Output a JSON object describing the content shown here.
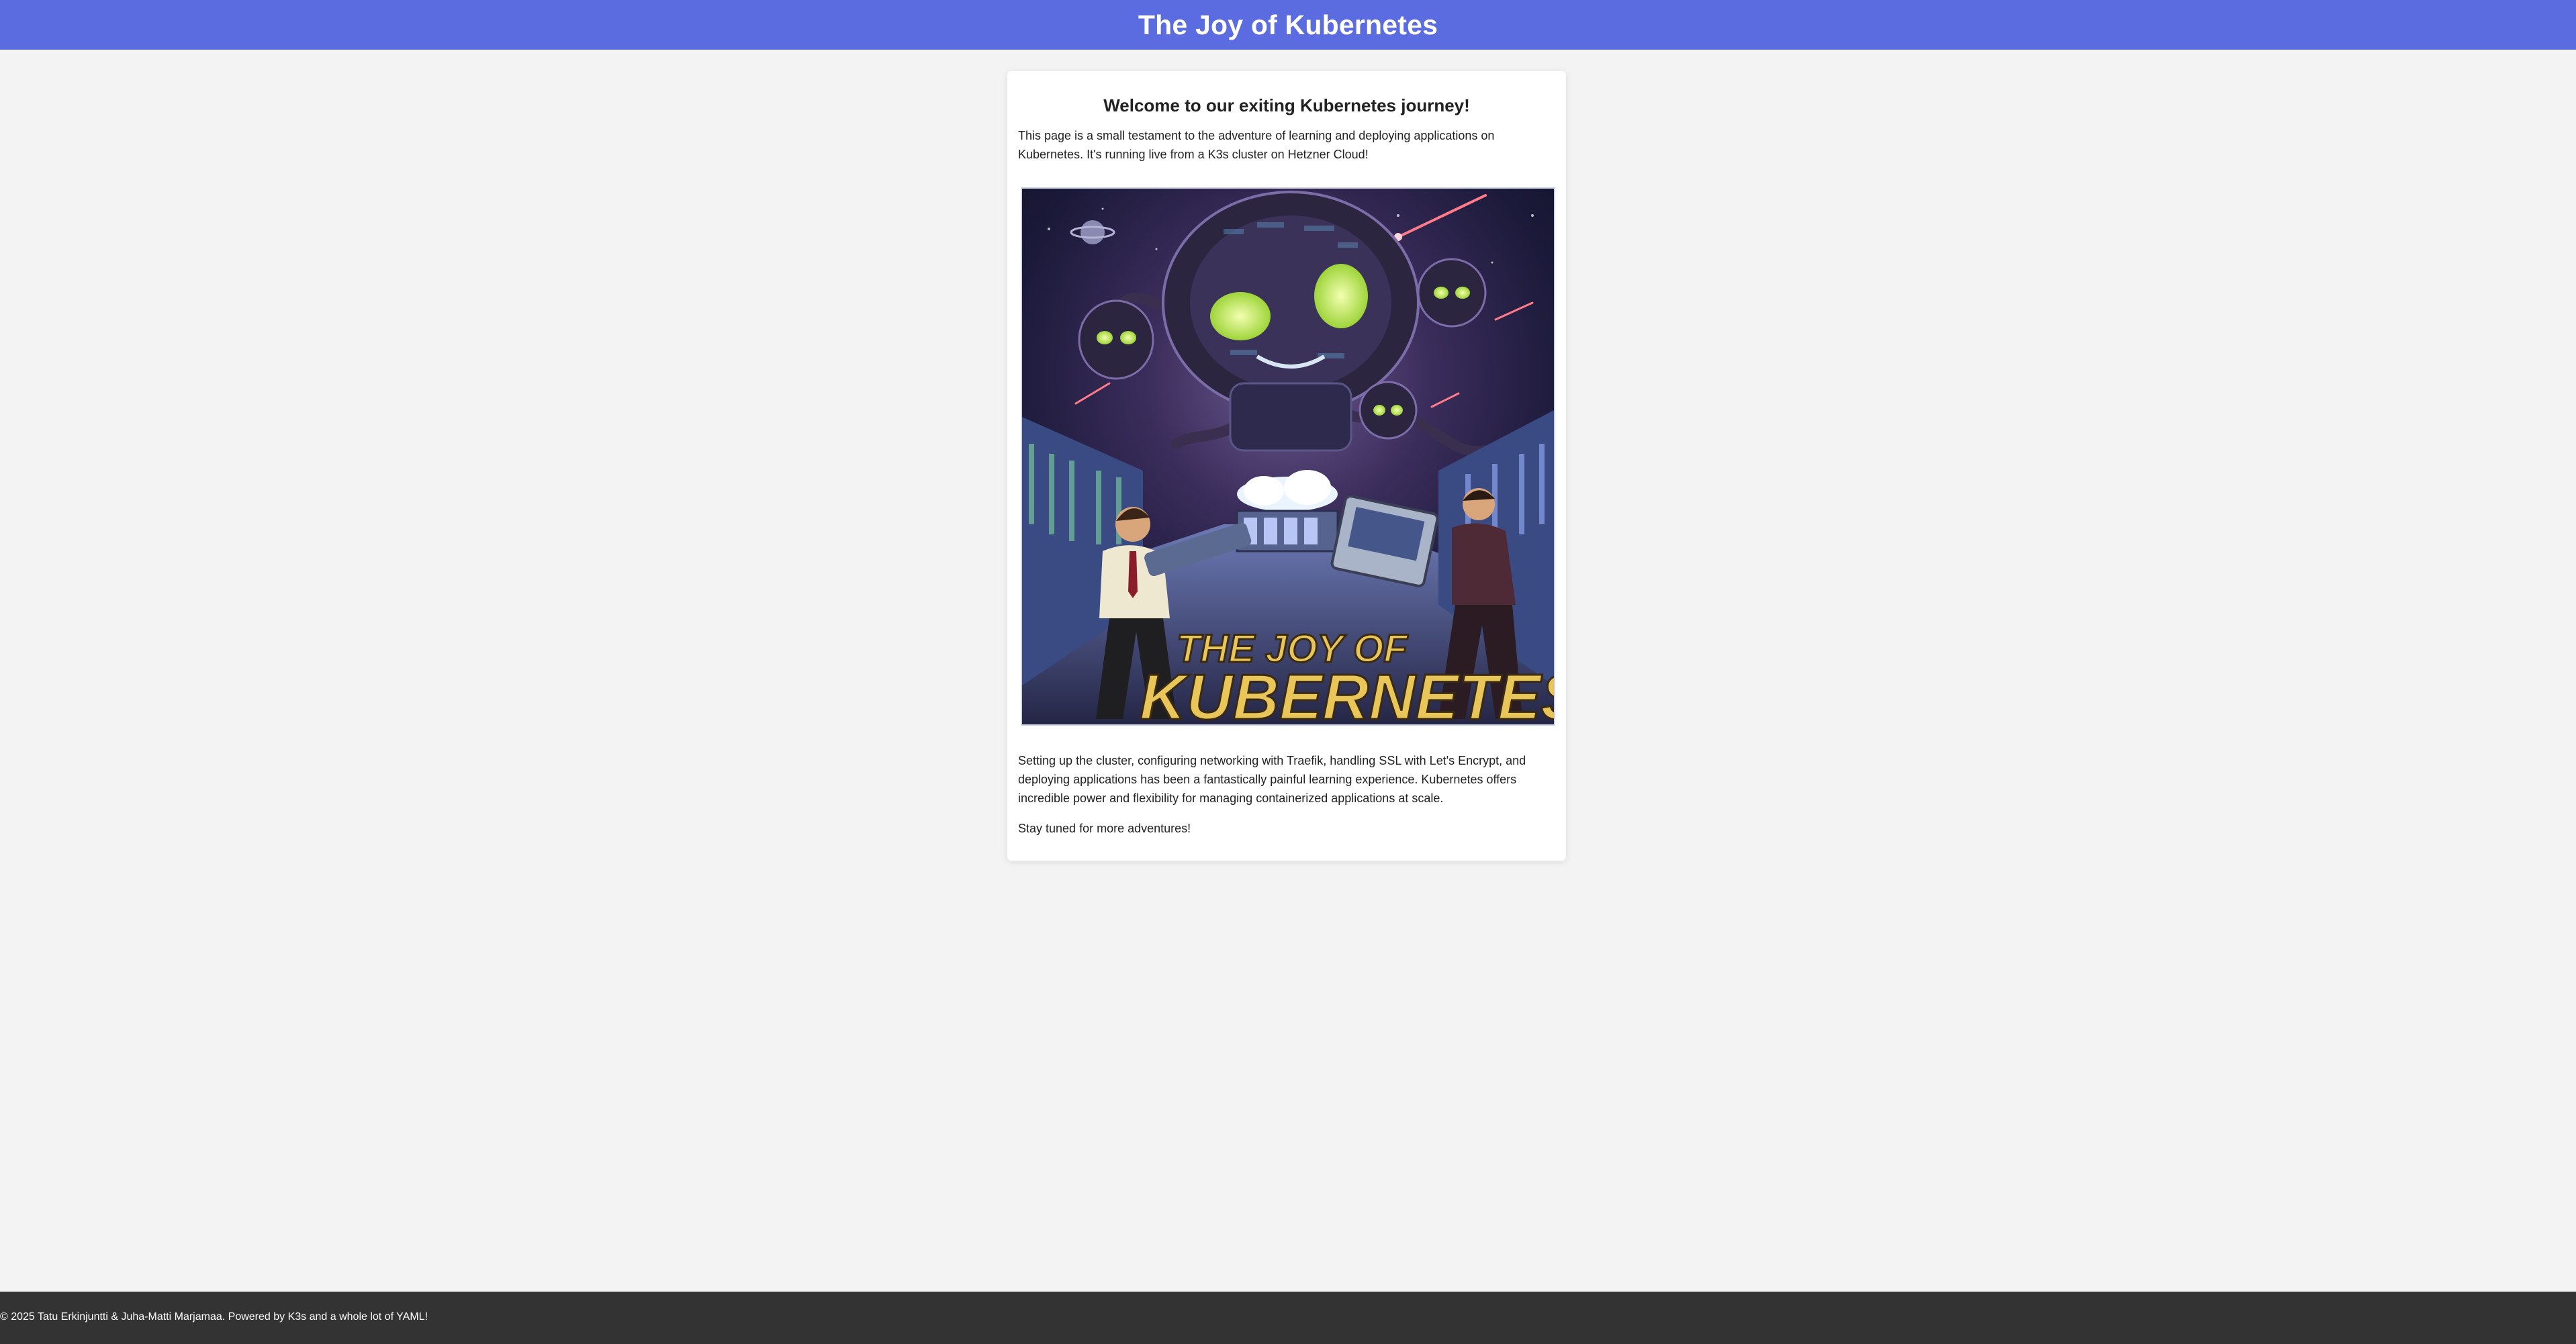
{
  "header": {
    "title": "The Joy of Kubernetes"
  },
  "main": {
    "heading": "Welcome to our exiting Kubernetes journey!",
    "intro": "This page is a small testament to the adventure of learning and deploying applications on Kubernetes. It's running live from a K3s cluster on Hetzner Cloud!",
    "body": "Setting up the cluster, configuring networking with Traefik, handling SSL with Let's Encrypt, and deploying applications has been a fantastically painful learning experience. Kubernetes offers incredible power and flexibility for managing containerized applications at scale.",
    "closing": "Stay tuned for more adventures!",
    "poster": {
      "line1": "THE JOY OF",
      "line2": "KUBERNETES"
    }
  },
  "footer": {
    "text": "© 2025 Tatu Erkinjuntti & Juha-Matti Marjamaa. Powered by K3s and a whole lot of YAML!"
  },
  "colors": {
    "header_bg": "#5b6be0",
    "page_bg": "#f3f3f3",
    "card_bg": "#ffffff",
    "footer_bg": "#333333",
    "poster_title": "#e9c659"
  }
}
